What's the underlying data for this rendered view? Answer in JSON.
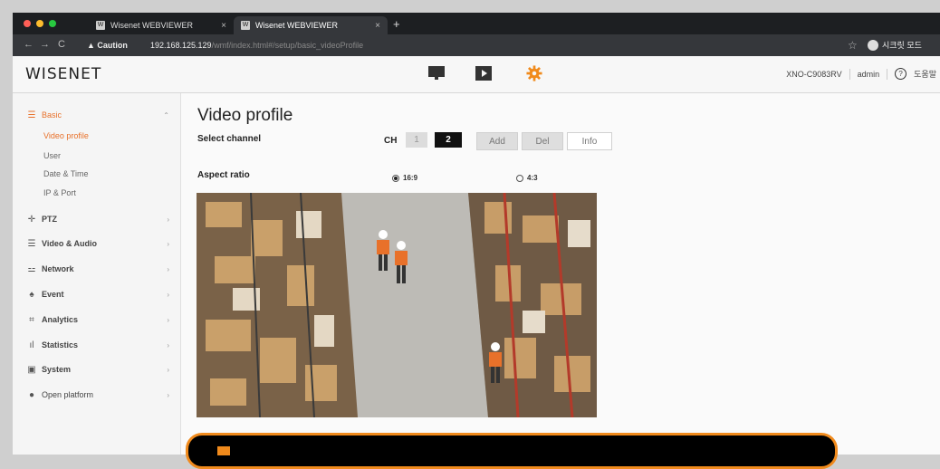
{
  "browser": {
    "tabs": [
      {
        "title": "Wisenet WEBVIEWER",
        "active": false
      },
      {
        "title": "Wisenet WEBVIEWER",
        "active": true
      }
    ],
    "caution": "Caution",
    "url_host": "192.168.125.129",
    "url_path": "/wmf/index.html#/setup/basic_videoProfile",
    "profile_label": "시크릿 모드"
  },
  "header": {
    "logo": "WISENET",
    "model": "XNO-C9083RV",
    "user": "admin",
    "help_label": "도움말"
  },
  "sidebar": {
    "menus": [
      {
        "label": "Basic",
        "icon": "list-icon",
        "active": true
      },
      {
        "label": "PTZ",
        "icon": "move-icon"
      },
      {
        "label": "Video & Audio",
        "icon": "lines-icon"
      },
      {
        "label": "Network",
        "icon": "network-icon"
      },
      {
        "label": "Event",
        "icon": "bell-icon"
      },
      {
        "label": "Analytics",
        "icon": "analytics-icon"
      },
      {
        "label": "Statistics",
        "icon": "bar-chart-icon"
      },
      {
        "label": "System",
        "icon": "system-icon"
      },
      {
        "label": "Open platform",
        "icon": "platform-icon"
      }
    ],
    "basic_sub": [
      {
        "label": "Video profile",
        "active": true
      },
      {
        "label": "User"
      },
      {
        "label": "Date & Time"
      },
      {
        "label": "IP & Port"
      }
    ]
  },
  "content": {
    "title": "Video profile",
    "select_channel_label": "Select channel",
    "ch_label": "CH",
    "channels": [
      "1",
      "2"
    ],
    "selected_channel": "2",
    "buttons": {
      "add": "Add",
      "del": "Del",
      "info": "Info"
    },
    "aspect_ratio_label": "Aspect ratio",
    "aspect_options": [
      "16:9",
      "4:3"
    ],
    "aspect_selected": "16:9"
  },
  "colors": {
    "accent": "#e8712a",
    "banner_border": "#f08a1c"
  }
}
